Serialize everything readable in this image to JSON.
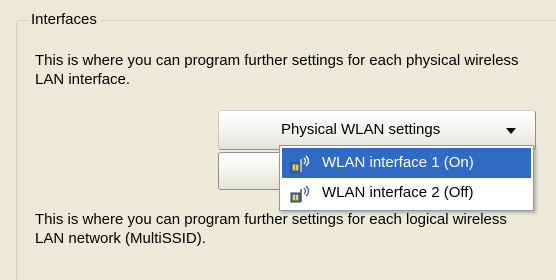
{
  "group": {
    "title": "Interfaces"
  },
  "paragraphs": {
    "physical": "This is where you can program further settings for each physical wireless LAN interface.",
    "logical": "This is where you can program further settings for each logical wireless LAN network (MultiSSID)."
  },
  "buttons": {
    "physical_wlan_label": "Physical WLAN settings"
  },
  "dropdown": {
    "items": [
      {
        "label": "WLAN interface 1 (On)",
        "icon": "wlan-antenna-icon",
        "selected": true
      },
      {
        "label": "WLAN interface 2 (Off)",
        "icon": "wlan-antenna-icon",
        "selected": false
      }
    ]
  },
  "colors": {
    "window_bg": "#ece9d8",
    "selection_bg": "#316ac5",
    "popup_border": "#7f9db9"
  }
}
